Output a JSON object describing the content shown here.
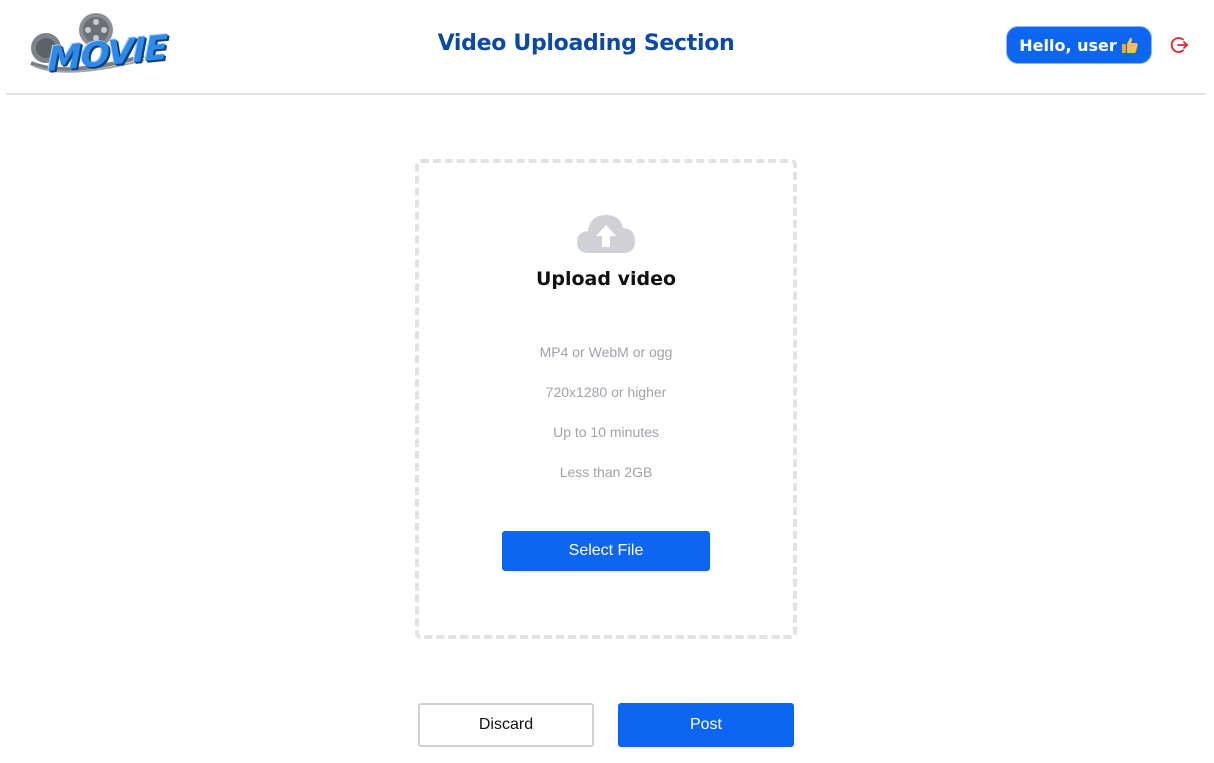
{
  "header": {
    "logo_text": "MOVIE",
    "title": "Video Uploading Section",
    "greeting": "Hello, user",
    "greeting_icon": "thumbs-up-icon",
    "logout_icon": "logout-icon"
  },
  "upload": {
    "icon": "cloud-upload-icon",
    "title": "Upload video",
    "requirements": [
      "MP4 or WebM or ogg",
      "720x1280 or higher",
      "Up to 10 minutes",
      "Less than 2GB"
    ],
    "select_label": "Select File"
  },
  "actions": {
    "discard_label": "Discard",
    "post_label": "Post"
  },
  "colors": {
    "accent": "#0d66f2",
    "title": "#0b49a6",
    "logout": "#e0262d",
    "muted_text": "#a0a3ab"
  }
}
